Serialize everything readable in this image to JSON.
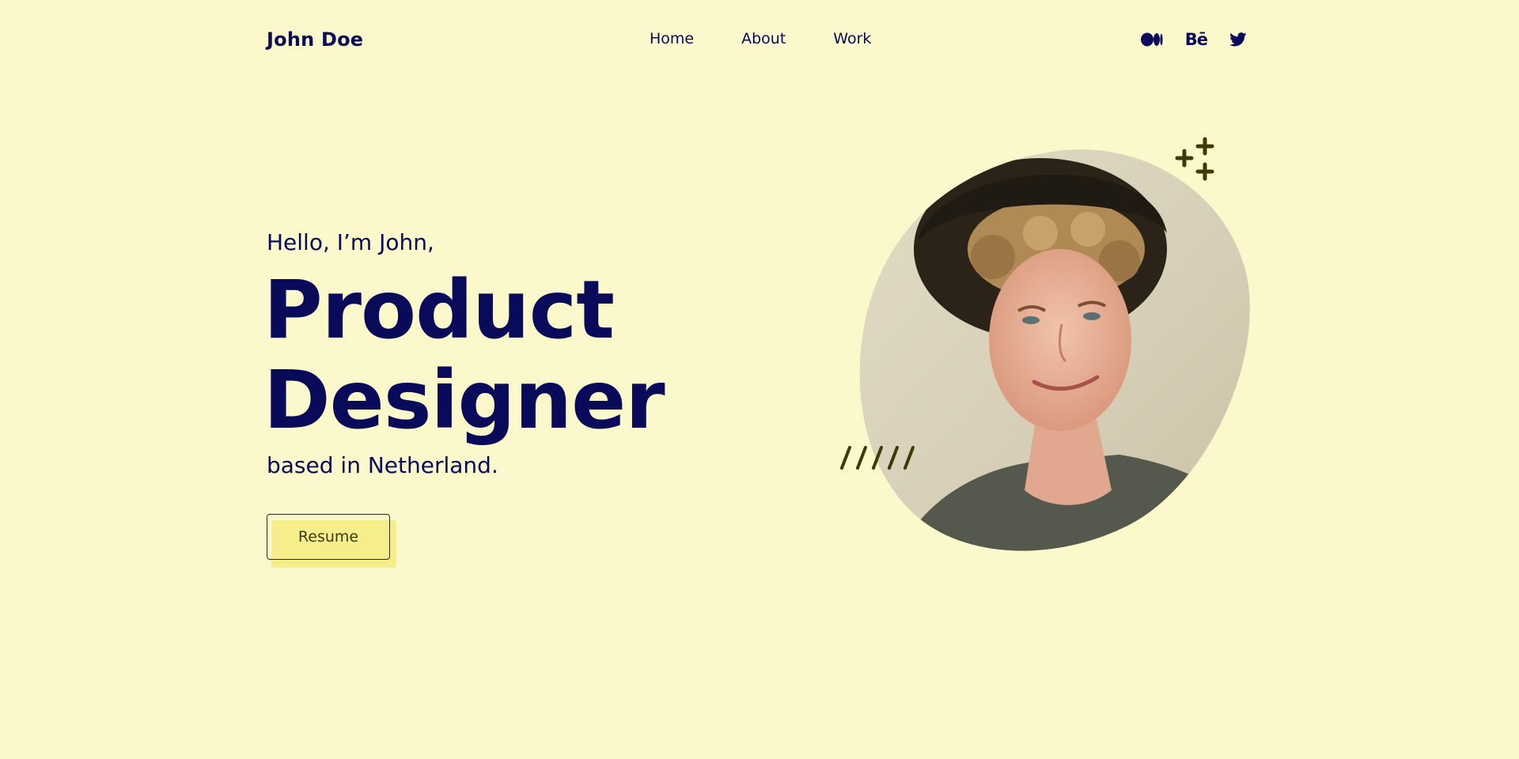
{
  "brand": {
    "name": "John Doe"
  },
  "nav": {
    "items": [
      {
        "label": "Home"
      },
      {
        "label": "About"
      },
      {
        "label": "Work"
      }
    ]
  },
  "socials": {
    "items": [
      {
        "icon": "medium-icon"
      },
      {
        "icon": "behance-icon",
        "text": "Bē"
      },
      {
        "icon": "twitter-icon"
      }
    ]
  },
  "hero": {
    "greeting": "Hello, I’m John,",
    "role_line1": "Product",
    "role_line2": "Designer",
    "location": "based in Netherland.",
    "resume_label": "Resume",
    "portrait_icon": "portrait-photo",
    "decorations": [
      "plus-icon",
      "slash-marks"
    ]
  },
  "colors": {
    "background": "#fbf8cc",
    "navy": "#0a0a5a",
    "button_fill": "#f5ee8a",
    "decor": "#3f3a05"
  }
}
